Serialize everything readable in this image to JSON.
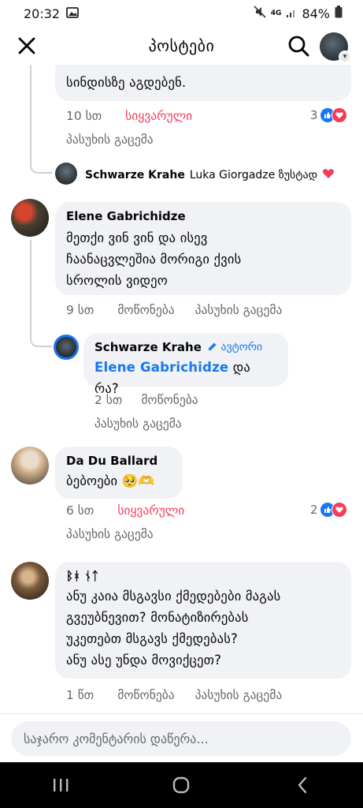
{
  "status_bar": {
    "time": "20:32",
    "network": "4G",
    "battery": "84%"
  },
  "header": {
    "title": "პოსტები"
  },
  "comments": {
    "c0": {
      "text_line1": "სინდისზე აგდებენ.",
      "time": "10 სთ",
      "reaction_label": "სიყვარული",
      "reply_label": "პასუხის გაცემა",
      "reaction_count": "3"
    },
    "c0_reply_preview": {
      "author": "Schwarze Krahe",
      "text": "Luka Giorgadze ზუსტად"
    },
    "c1": {
      "author": "Elene Gabrichidze",
      "lines": [
        "მეთქი ვინ ვინ და ისევ",
        "ჩაანაცვლეშია მორიგი ქვის",
        "სროლის ვიდეო"
      ],
      "time": "9 სთ",
      "like_label": "მოწონება",
      "reply_label": "პასუხის გაცემა"
    },
    "c1_reply": {
      "author": "Schwarze Krahe",
      "badge": "ავტორი",
      "mention": "Elene Gabrichidze",
      "text": "და რა?",
      "time": "2 სთ",
      "like_label": "მოწონება",
      "reply_label": "პასუხის გაცემა"
    },
    "c2": {
      "author": "Da Du Ballard",
      "text": "ბებოები 🥺🫶",
      "time": "6 სთ",
      "reaction_label": "სიყვარული",
      "reply_label": "პასუხის გაცემა",
      "reaction_count": "2"
    },
    "c3": {
      "author": "ᛒᚼ ᚾᛏ",
      "lines": [
        "ანუ კაია მსგავსი ქმედებები მაგას",
        "გვეუბნევით? მონატიზირებას",
        "უკეთებთ მსგავს ქმედებას?",
        "ანუ ასე უნდა მოვიქცეთ?"
      ],
      "time": "1 წთ",
      "like_label": "მოწონება",
      "reply_label": "პასუხის გაცემა"
    }
  },
  "composer": {
    "placeholder": "საჯარო კომენტარის დაწერა..."
  },
  "colors": {
    "accent": "#1877f2",
    "love": "#f33e58",
    "bubble": "#f0f2f5",
    "muted": "#65676b"
  }
}
